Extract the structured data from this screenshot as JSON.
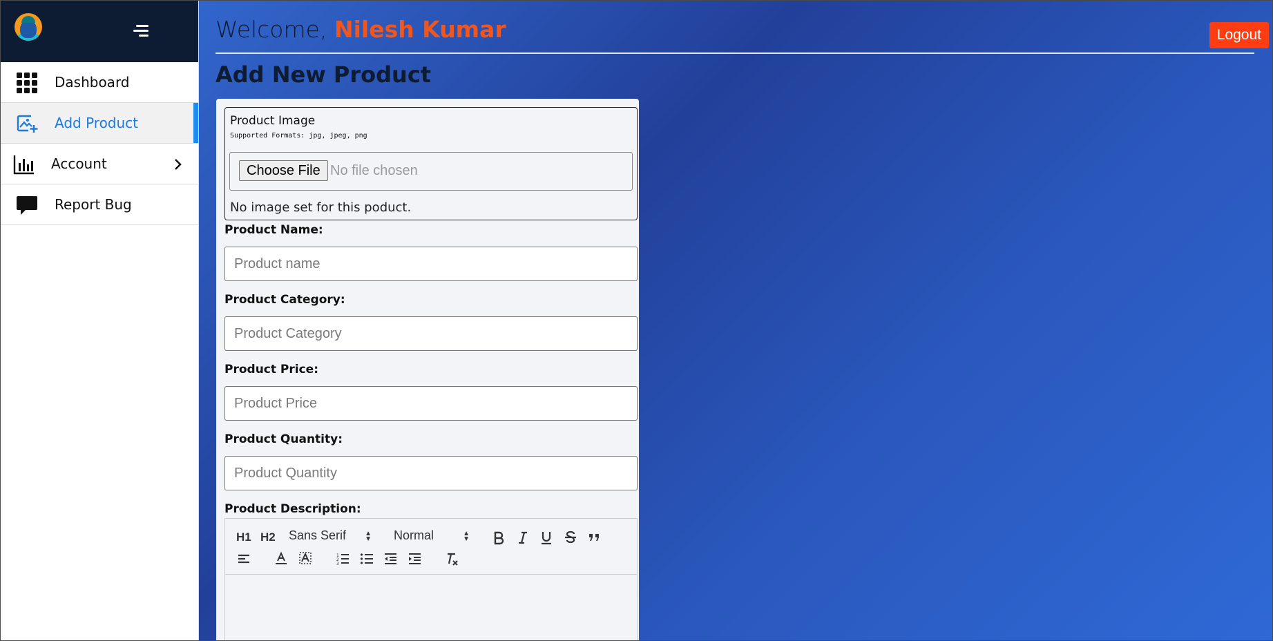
{
  "sidebar": {
    "items": [
      {
        "label": "Dashboard",
        "icon": "grid-icon"
      },
      {
        "label": "Add Product",
        "icon": "add-image-icon",
        "active": true
      },
      {
        "label": "Account",
        "icon": "bar-chart-icon"
      },
      {
        "label": "Report Bug",
        "icon": "chat-bubble-icon"
      }
    ]
  },
  "header": {
    "welcome_prefix": "Welcome,",
    "user_name": "Nilesh Kumar",
    "logout_label": "Logout"
  },
  "page": {
    "title": "Add New Product"
  },
  "form": {
    "image": {
      "title": "Product Image",
      "formats": "Supported Formats: jpg, jpeg, png",
      "choose_label": "Choose File",
      "no_file": "No file chosen",
      "note": "No image set for this poduct."
    },
    "name": {
      "label": "Product Name:",
      "placeholder": "Product name"
    },
    "category": {
      "label": "Product Category:",
      "placeholder": "Product Category"
    },
    "price": {
      "label": "Product Price:",
      "placeholder": "Product Price"
    },
    "quantity": {
      "label": "Product Quantity:",
      "placeholder": "Product Quantity"
    },
    "description": {
      "label": "Product Description:"
    }
  },
  "editor": {
    "font": "Sans Serif",
    "size": "Normal",
    "h1": "H1",
    "h2": "H2"
  },
  "colors": {
    "sidebar_top": "#0d1b33",
    "accent": "#1d8cf0",
    "name": "#f1561c",
    "logout": "#ff3d12",
    "main_bg": "#2a58bd"
  }
}
